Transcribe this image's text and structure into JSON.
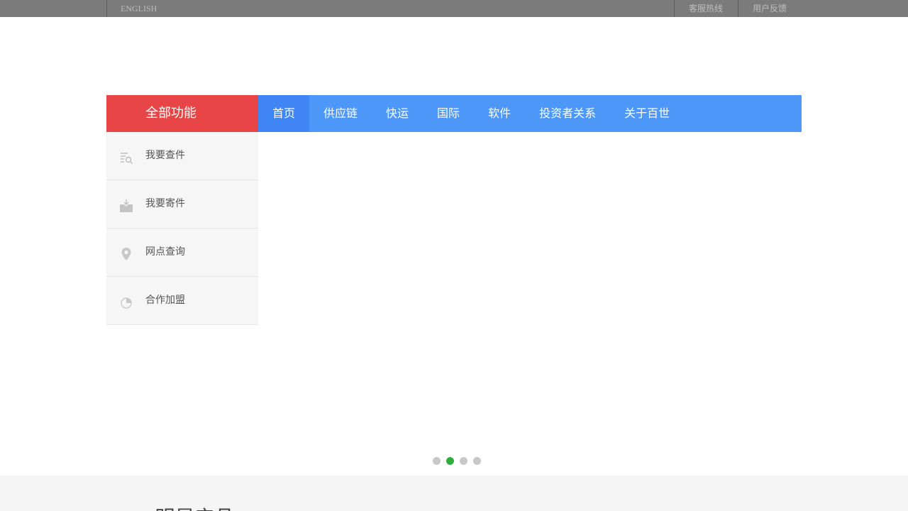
{
  "topbar": {
    "english": "ENGLISH",
    "hotline": "客服热线",
    "feedback": "用户反馈"
  },
  "nav": {
    "all_functions": "全部功能",
    "items": [
      "首页",
      "供应链",
      "快运",
      "国际",
      "软件",
      "投资者关系",
      "关于百世"
    ],
    "active_index": 0
  },
  "sidemenu": {
    "items": [
      {
        "label": "我要查件",
        "icon": "track-search-icon"
      },
      {
        "label": "我要寄件",
        "icon": "send-package-icon"
      },
      {
        "label": "网点查询",
        "icon": "location-pin-icon"
      },
      {
        "label": "合作加盟",
        "icon": "pie-chart-icon"
      }
    ]
  },
  "carousel": {
    "total": 4,
    "active_index": 1
  },
  "section": {
    "heading": "BEST明星产品"
  },
  "colors": {
    "topbar": "#7b7b7b",
    "all_functions_bg": "#e84646",
    "nav_bg": "#4d97f8",
    "nav_active_bg": "#3f86f4",
    "dot_active": "#2fae3f",
    "dot_inactive": "#c8c8c8"
  }
}
